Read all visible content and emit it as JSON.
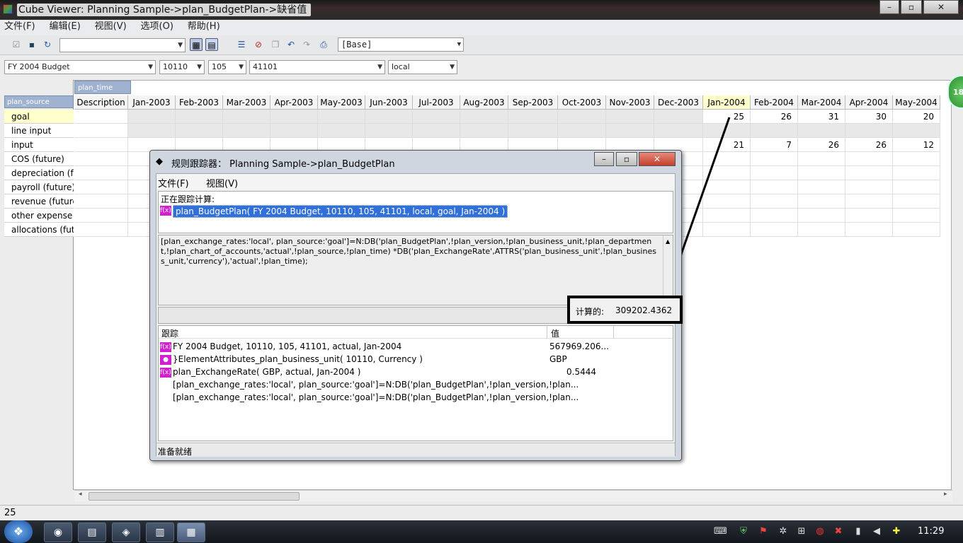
{
  "window": {
    "title": "Cube Viewer: Planning Sample->plan_BudgetPlan->缺省值"
  },
  "menu": [
    "文件(F)",
    "编辑(E)",
    "视图(V)",
    "选项(O)",
    "帮助(H)"
  ],
  "toolbar": {
    "view_select": "[Base]"
  },
  "dims": {
    "version": "FY 2004 Budget",
    "business_unit": "10110",
    "department": "105",
    "account": "41101",
    "currency": "local"
  },
  "grid": {
    "col_dim": "plan_time",
    "row_dim": "plan_source",
    "columns": [
      "Description",
      "Jan-2003",
      "Feb-2003",
      "Mar-2003",
      "Apr-2003",
      "May-2003",
      "Jun-2003",
      "Jul-2003",
      "Aug-2003",
      "Sep-2003",
      "Oct-2003",
      "Nov-2003",
      "Dec-2003",
      "Jan-2004",
      "Feb-2004",
      "Mar-2004",
      "Apr-2004",
      "May-2004"
    ],
    "rows": [
      "goal",
      "line input",
      "input",
      "COS (future)",
      "depreciation (fu",
      "payroll (future)",
      "revenue (future",
      "other expense (",
      "allocations (futu"
    ],
    "goal_values": [
      "25",
      "26",
      "31",
      "30",
      "20"
    ],
    "input_values": [
      "21",
      "7",
      "26",
      "26",
      "12"
    ]
  },
  "status_value": "25",
  "dialog": {
    "title": "规则跟踪器： Planning Sample->plan_BudgetPlan",
    "menu": [
      "文件(F)",
      "视图(V)"
    ],
    "tracing_label": "正在跟踪计算:",
    "tracing_cell": "plan_BudgetPlan( FY 2004 Budget, 10110, 105, 41101, local, goal, Jan-2004 )",
    "rule_text": "[plan_exchange_rates:'local', plan_source:'goal']=N:DB('plan_BudgetPlan',!plan_version,!plan_business_unit,!plan_department,!plan_chart_of_accounts,'actual',!plan_source,!plan_time) *DB('plan_ExchangeRate',ATTRS('plan_business_unit',!plan_business_unit,'currency'),'actual',!plan_time);",
    "calc_label": "计算的:",
    "calc_value": "309202.4362",
    "col_trace": "跟踪",
    "col_value": "值",
    "rows": [
      {
        "icon": "f(x)",
        "text": "FY 2004 Budget, 10110, 105, 41101, actual, Jan-2004",
        "value": "567969.206..."
      },
      {
        "icon": "●",
        "text": "}ElementAttributes_plan_business_unit( 10110, Currency )",
        "value": "GBP"
      },
      {
        "icon": "f(x)",
        "text": "plan_ExchangeRate( GBP, actual, Jan-2004 )",
        "value": "0.5444"
      },
      {
        "icon": "",
        "text": "[plan_exchange_rates:'local', plan_source:'goal']=N:DB('plan_BudgetPlan',!plan_version,!plan...",
        "value": ""
      },
      {
        "icon": "",
        "text": "[plan_exchange_rates:'local', plan_source:'goal']=N:DB('plan_BudgetPlan',!plan_version,!plan...",
        "value": ""
      }
    ],
    "status": "准备就绪"
  },
  "badge": "18",
  "clock": "11:29"
}
